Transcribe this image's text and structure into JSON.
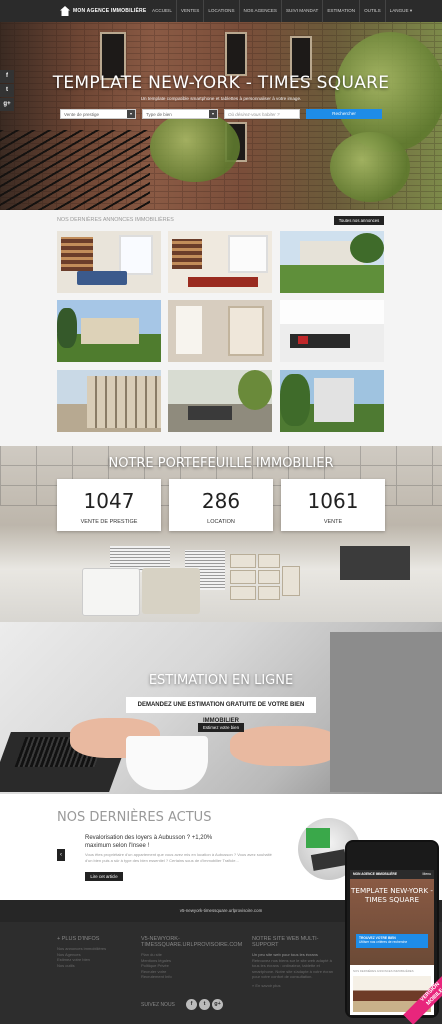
{
  "brand": {
    "name": "MON AGENCE IMMOBILIÈRE"
  },
  "nav": {
    "items": [
      "ACCUEIL",
      "VENTES",
      "LOCATIONS",
      "NOS AGENCES",
      "SUIVI MANDAT",
      "ESTIMATION",
      "OUTILS",
      "LANGUE ▾"
    ]
  },
  "hero": {
    "title": "TEMPLATE NEW-YORK - TIMES SQUARE",
    "subtitle": "Un template compatible smartphone et tablettes à personnaliser à votre image.",
    "search": {
      "field1": "Vente de prestige",
      "field2": "Type de bien",
      "field3_placeholder": "Où désirez-vous habiter ?",
      "button": "Rechercher"
    }
  },
  "social": {
    "items": [
      "f",
      "t",
      "g+"
    ]
  },
  "listings": {
    "label": "NOS DERNIÈRES ANNONCES IMMOBILIÈRES",
    "all_button": "Toutes nos annonces"
  },
  "portfolio": {
    "title": "NOTRE PORTEFEUILLE IMMOBILIER",
    "stats": [
      {
        "value": "1047",
        "label": "VENTE DE PRESTIGE"
      },
      {
        "value": "286",
        "label": "LOCATION"
      },
      {
        "value": "1061",
        "label": "VENTE"
      }
    ]
  },
  "estimation": {
    "title": "ESTIMATION EN LIGNE",
    "tagline": "DEMANDEZ UNE ESTIMATION GRATUITE DE VOTRE BIEN IMMOBILIER",
    "button": "Estimez votre bien"
  },
  "news": {
    "title": "NOS DERNIÈRES ACTUS",
    "headline": "Revalorisation des loyers à Aubusson ? +1,20% maximum selon l'Insee !",
    "excerpt": "Vous êtes propriétaire d'un appartement que vous avez mis en location à Aubusson ? Vous avez souhaité d'un bien puis a sûr à type des bien essentiel ? Certains sous de d'immobilier Traficle...",
    "button": "Lire cet article",
    "arrow": "‹"
  },
  "footer": {
    "url": "v5-newyork-timessquare.urlprovisoire.com",
    "col1": {
      "heading": "+ PLUS D'INFOS",
      "links": [
        "Nos annonces immobilières",
        "Nos Agences",
        "Estimez votre bien",
        "Nos outils"
      ]
    },
    "col2": {
      "heading": "V5-NEWYORK-TIMESSQUARE.URLPROVISOIRE.COM",
      "links": [
        "Plan du site",
        "Mentions légales",
        "Politique Privée",
        "Recruter votre",
        "Recrutement Info"
      ]
    },
    "col3": {
      "heading": "NOTRE SITE WEB MULTI-SUPPORT",
      "subheading": "Un peu site web pour tous les écrans",
      "text": "Retrouvez nos biens sur le site web adapté à tous les écrans : ordinateur, tablette et smartphone. Notre site s'adapte à votre écran pour votre confort de consultation.",
      "link": "» En savoir plus"
    },
    "follow": "SUIVEZ NOUS",
    "social": [
      "f",
      "t",
      "g+"
    ]
  },
  "mobile": {
    "brand": "MON AGENCE IMMOBILIÈRE",
    "menu": "Menu",
    "title": "TEMPLATE NEW-YORK - TIMES SQUARE",
    "cta_line1": "TROUVEZ VOTRE BIEN",
    "cta_line2": "Utiliser nos critères de recherche",
    "section": "NOS DERNIÈRES ANNONCES IMMOBILIÈRES",
    "ribbon_line1": "VERSION",
    "ribbon_line2": "MOBILE"
  },
  "colors": {
    "accent": "#1e8ce8",
    "dark": "#2b2b2b",
    "ribbon": "#e8267c"
  }
}
